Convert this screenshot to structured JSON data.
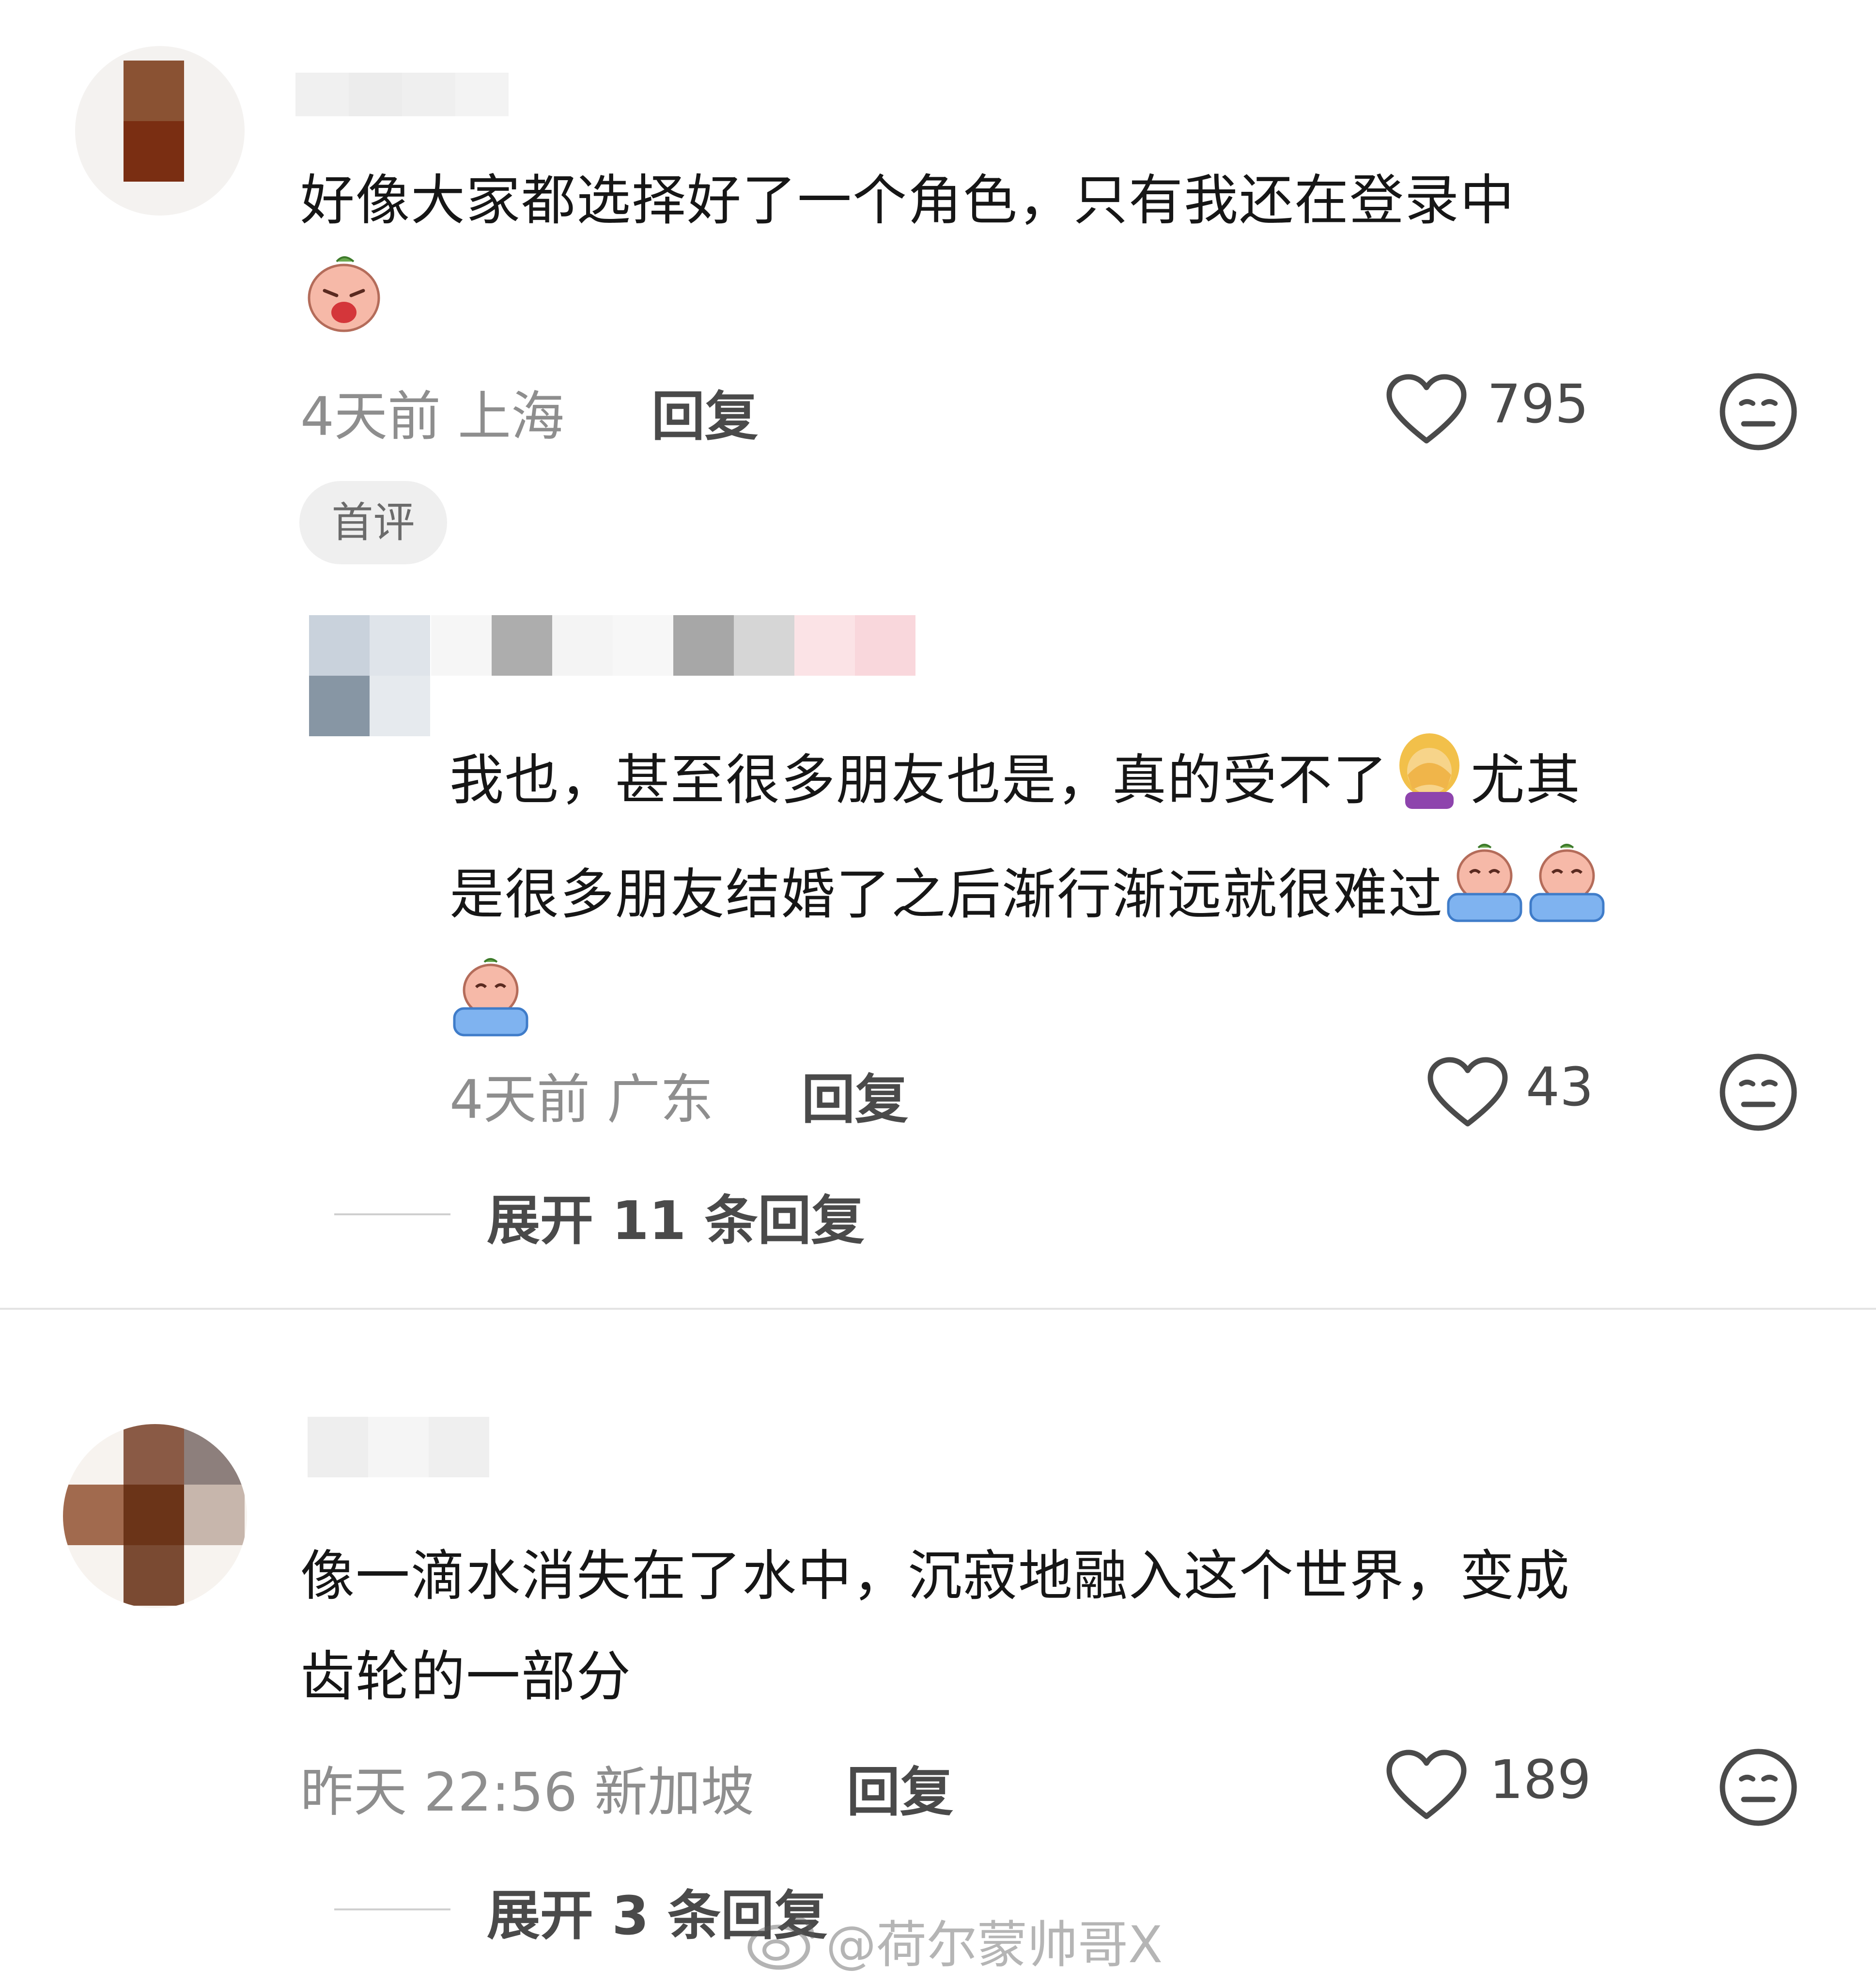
{
  "comments": [
    {
      "text": "好像大家都选择好了一个角色，只有我还在登录中",
      "meta": "4天前 上海",
      "reply_label": "回复",
      "likes": "795",
      "badge": "首评",
      "reply": {
        "text_line1": "我也，甚至很多朋友也是，真的受不了",
        "text_line1b": "尤其",
        "text_line2": "是很多朋友结婚了之后渐行渐远就很难过",
        "meta": "4天前 广东",
        "reply_label": "回复",
        "likes": "43"
      },
      "expand_label": "展开 11 条回复"
    },
    {
      "text_line1": "像一滴水消失在了水中，沉寂地融入这个世界，变成",
      "text_line2": "齿轮的一部分",
      "meta": "昨天 22:56 新加坡",
      "reply_label": "回复",
      "likes": "189",
      "expand_label": "展开 3 条回复"
    }
  ],
  "watermark": "@荷尔蒙帅哥X",
  "icons": {
    "like": "heart-outline-icon",
    "react": "neutral-face-icon",
    "weibo": "weibo-logo-icon"
  }
}
